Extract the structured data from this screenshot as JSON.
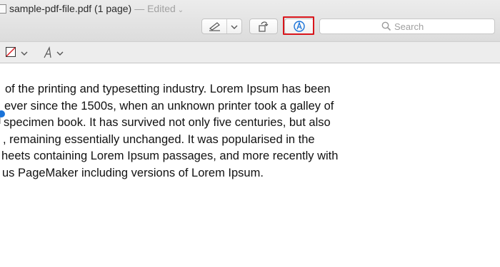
{
  "window": {
    "title": "sample-pdf-file.pdf (1 page)",
    "separator": "—",
    "status": "Edited"
  },
  "toolbar": {
    "search_placeholder": "Search",
    "highlight_color": "#d9151b",
    "accent_color": "#1a73d9"
  },
  "document": {
    "lines": [
      "of the printing and typesetting industry. Lorem Ipsum has been",
      "ever since the 1500s, when an unknown printer took a galley of",
      "specimen book. It has survived not only five centuries, but also",
      ", remaining essentially unchanged. It was popularised in the",
      "heets containing Lorem Ipsum passages, and more recently with",
      "us PageMaker including versions of Lorem Ipsum."
    ]
  }
}
